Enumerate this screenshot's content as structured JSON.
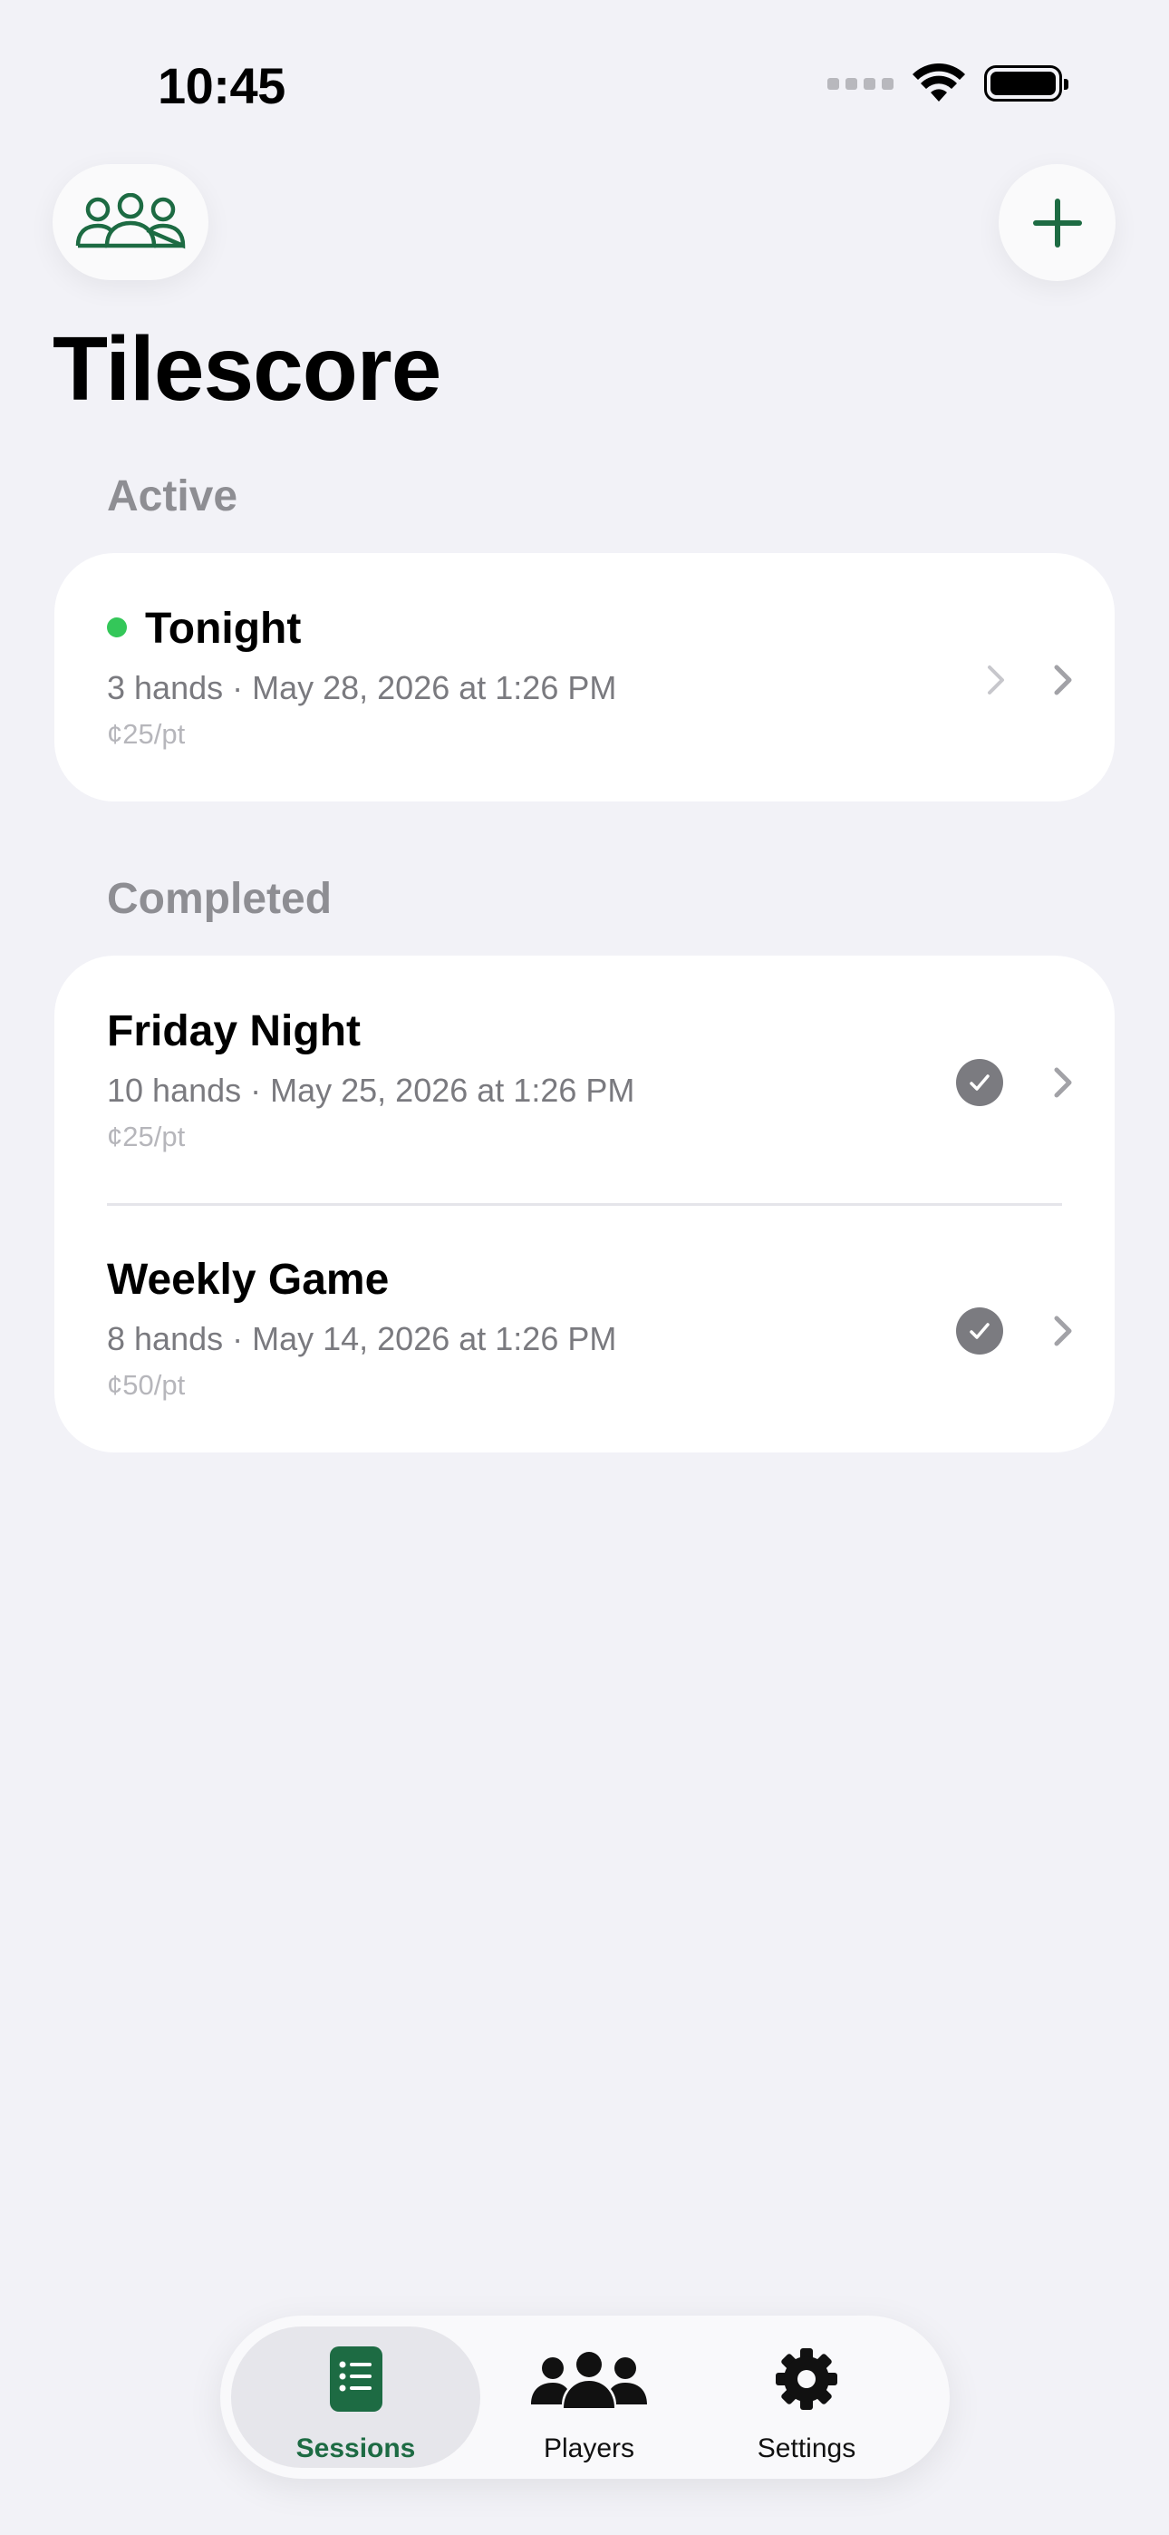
{
  "status_bar": {
    "time": "10:45"
  },
  "header": {
    "title": "Tilescore",
    "left_button_icon": "people-icon",
    "right_button_icon": "plus-icon"
  },
  "colors": {
    "accent": "#1d6b43",
    "live": "#34c759",
    "secondary_text": "#8e8e93",
    "background": "#f2f2f7"
  },
  "sections": {
    "active": {
      "header": "Active",
      "items": [
        {
          "title": "Tonight",
          "meta": "3 hands · May 28, 2026 at 1:26 PM",
          "rate": "¢25/pt",
          "status": "live"
        }
      ]
    },
    "completed": {
      "header": "Completed",
      "items": [
        {
          "title": "Friday Night",
          "meta": "10 hands · May 25, 2026 at 1:26 PM",
          "rate": "¢25/pt",
          "status": "completed"
        },
        {
          "title": "Weekly Game",
          "meta": "8 hands · May 14, 2026 at 1:26 PM",
          "rate": "¢50/pt",
          "status": "completed"
        }
      ]
    }
  },
  "tab_bar": {
    "tabs": [
      {
        "label": "Sessions",
        "icon": "list-icon",
        "selected": true
      },
      {
        "label": "Players",
        "icon": "people-icon",
        "selected": false
      },
      {
        "label": "Settings",
        "icon": "gear-icon",
        "selected": false
      }
    ]
  }
}
